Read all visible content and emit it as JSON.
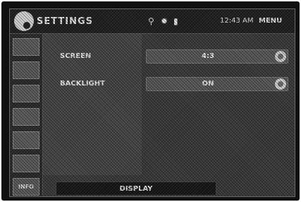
{
  "header": {
    "title": "SETTINGS",
    "time": "12:43 AM",
    "menu_label": "MENU"
  },
  "sidebar": {
    "items": [
      "",
      "",
      "",
      "",
      "",
      "",
      "INFO"
    ]
  },
  "settings": {
    "rows": [
      {
        "label": "SCREEN",
        "value": "4:3"
      },
      {
        "label": "BACKLIGHT",
        "value": "ON"
      }
    ]
  },
  "footer": {
    "tab_label": "DISPLAY"
  }
}
